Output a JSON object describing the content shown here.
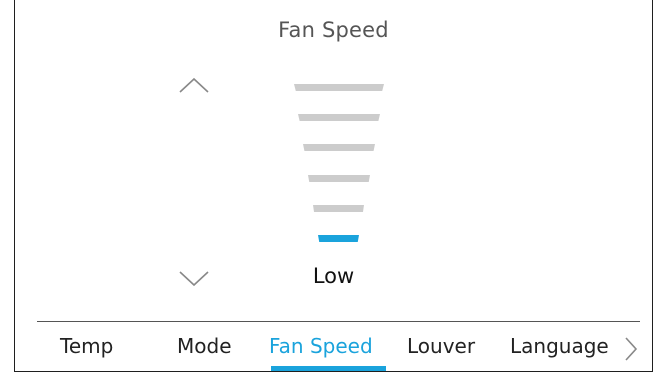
{
  "screen": {
    "title": "Fan Speed",
    "current_level": "Low",
    "level_count": 6,
    "selected_level_index": 1,
    "active_color": "#1aa3dc",
    "inactive_color": "#cccccc"
  },
  "controls": {
    "up_icon": "chevron-up-icon",
    "down_icon": "chevron-down-icon"
  },
  "tabs": [
    {
      "label": "Temp",
      "active": false
    },
    {
      "label": "Mode",
      "active": false
    },
    {
      "label": "Fan Speed",
      "active": true
    },
    {
      "label": "Louver",
      "active": false
    },
    {
      "label": "Language",
      "active": false
    }
  ],
  "nav": {
    "next_icon": "chevron-right-icon"
  }
}
